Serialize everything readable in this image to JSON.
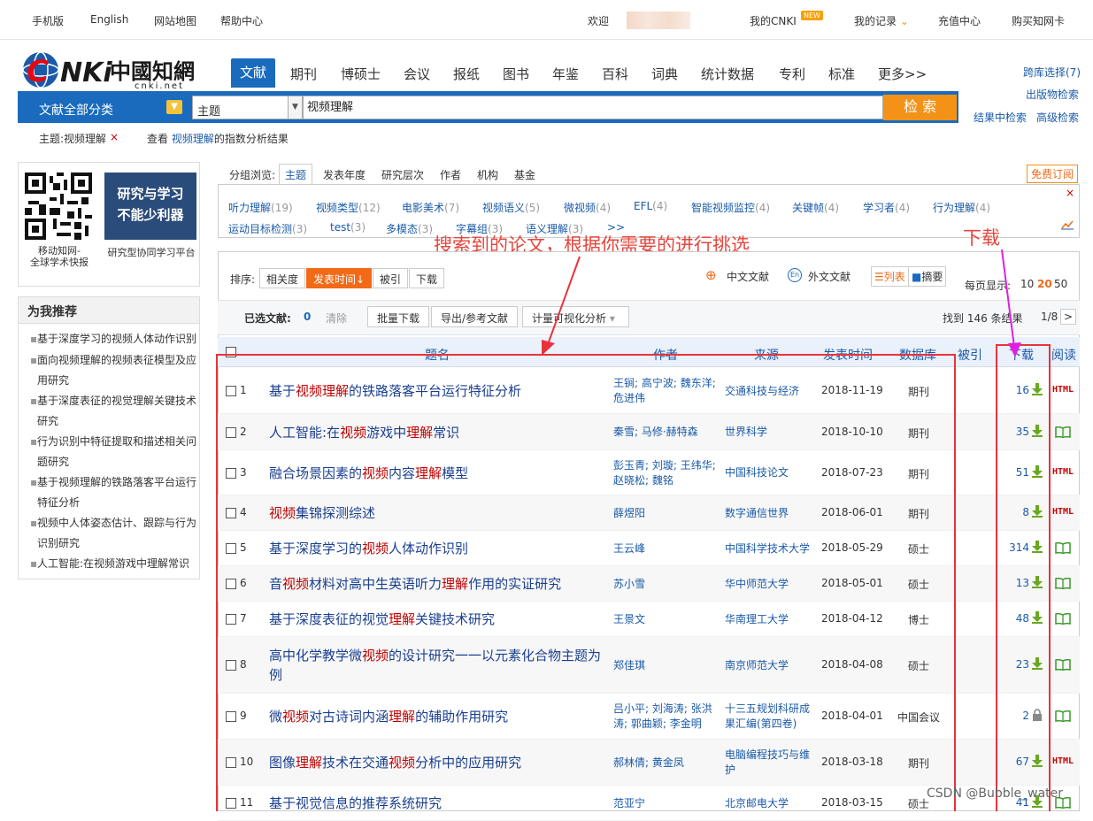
{
  "topbar": {
    "mobile": "手机版",
    "english": "English",
    "sitemap": "网站地图",
    "help": "帮助中心",
    "welcome": "欢迎",
    "mycnki": "我的CNKI",
    "new_badge": "NEW",
    "myrecords": "我的记录",
    "recharge": "充值中心",
    "buycard": "购买知网卡"
  },
  "logo": {
    "text": "CNKI中国知网",
    "url_text": "cnki.net"
  },
  "nav": [
    "文献",
    "期刊",
    "博硕士",
    "会议",
    "报纸",
    "图书",
    "年鉴",
    "百科",
    "词典",
    "统计数据",
    "专利",
    "标准",
    "更多>>"
  ],
  "right_links": {
    "cross": "跨库选择(7)",
    "pubsearch": "出版物检索",
    "inresult": "结果中检索",
    "advanced": "高级检索"
  },
  "search": {
    "category": "文献全部分类",
    "field": "主题",
    "keyword": "视频理解",
    "button": "检 索"
  },
  "crumb": {
    "topic": "主题:视频理解",
    "close": "×",
    "view_prefix": "查看",
    "view_kw": "视频理解",
    "view_suffix": "的指数分析结果"
  },
  "left": {
    "qr_caption1": "移动知网-",
    "qr_caption2": "全球学术快报",
    "promo_line1": "研究与学习",
    "promo_line2": "不能少利器",
    "promo_caption": "研究型协同学习平台",
    "rec_title": "为我推荐",
    "recs": [
      "基于深度学习的视频人体动作识别",
      "面向视频理解的视频表征模型及应",
      "用研究",
      "基于深度表征的视觉理解关键技术",
      "研究",
      "行为识别中特征提取和描述相关问",
      "题研究",
      "基于视频理解的铁路落客平台运行",
      "特征分析",
      "视频中人体姿态估计、跟踪与行为",
      "识别研究",
      "人工智能:在视频游戏中理解常识"
    ]
  },
  "group": {
    "label": "分组浏览:",
    "tabs": [
      "主题",
      "发表年度",
      "研究层次",
      "作者",
      "机构",
      "基金"
    ],
    "subscribe": "免费订阅"
  },
  "facets": [
    [
      "听力理解",
      "(19)"
    ],
    [
      "视频类型",
      "(12)"
    ],
    [
      "电影美术",
      "(7)"
    ],
    [
      "视频语义",
      "(5)"
    ],
    [
      "微视频",
      "(4)"
    ],
    [
      "EFL",
      "(4)"
    ],
    [
      "智能视频监控",
      "(4)"
    ],
    [
      "关键帧",
      "(4)"
    ],
    [
      "学习者",
      "(4)"
    ],
    [
      "行为理解",
      "(4)"
    ],
    [
      "运动目标检测",
      "(3)"
    ],
    [
      "test",
      "(3)"
    ],
    [
      "多模态",
      "(3)"
    ],
    [
      "字幕组",
      "(3)"
    ],
    [
      "语义理解",
      "(3)"
    ],
    [
      ">>",
      ""
    ]
  ],
  "annot": {
    "left": "搜索到的论文，根据你需要的进行挑选",
    "right": "下载"
  },
  "sort": {
    "label": "排序:",
    "options": [
      "相关度",
      "发表时间↓",
      "被引",
      "下载"
    ],
    "zh": "中文文献",
    "en": "外文文献",
    "list": "列表",
    "abstract": "摘要",
    "perpage": "每页显示:",
    "pp": [
      "10",
      "20",
      "50"
    ]
  },
  "toolbar": {
    "selected": "已选文献:",
    "count": "0",
    "clear": "清除",
    "batch": "批量下载",
    "export": "导出/参考文献",
    "viz": "计量可视化分析",
    "found": "找到 146 条结果",
    "page": "1/8",
    "next": ">"
  },
  "columns": [
    "题名",
    "作者",
    "来源",
    "发表时间",
    "数据库",
    "被引",
    "下载",
    "阅读"
  ],
  "rows": [
    {
      "n": "1",
      "title": [
        [
          "基于",
          0
        ],
        [
          "视频理解",
          1
        ],
        [
          "的铁路落客平台运行特征分析",
          0
        ]
      ],
      "authors": [
        "王锏; 高宁波; 魏东洋;",
        "危进伟"
      ],
      "source": [
        "交通科技与经济"
      ],
      "date": "2018-11-19",
      "db": "期刊",
      "dl": "16",
      "read": "HTML"
    },
    {
      "n": "2",
      "title": [
        [
          "人工智能:在",
          0
        ],
        [
          "视频",
          1
        ],
        [
          "游戏中",
          0
        ],
        [
          "理解",
          1
        ],
        [
          "常识",
          0
        ]
      ],
      "authors": [
        "秦雪; 马修·赫特森"
      ],
      "source": [
        "世界科学"
      ],
      "date": "2018-10-10",
      "db": "期刊",
      "dl": "35",
      "read": "book"
    },
    {
      "n": "3",
      "title": [
        [
          "融合场景因素的",
          0
        ],
        [
          "视频",
          1
        ],
        [
          "内容",
          0
        ],
        [
          "理解",
          1
        ],
        [
          "模型",
          0
        ]
      ],
      "authors": [
        "彭玉青; 刘璇; 王纬华;",
        "赵晓松; 魏铭"
      ],
      "source": [
        "中国科技论文"
      ],
      "date": "2018-07-23",
      "db": "期刊",
      "dl": "51",
      "read": "HTML"
    },
    {
      "n": "4",
      "title": [
        [
          "视频",
          1
        ],
        [
          "集锦探测综述",
          0
        ]
      ],
      "authors": [
        "薛煜阳"
      ],
      "source": [
        "数字通信世界"
      ],
      "date": "2018-06-01",
      "db": "期刊",
      "dl": "8",
      "read": "HTML"
    },
    {
      "n": "5",
      "title": [
        [
          "基于深度学习的",
          0
        ],
        [
          "视频",
          1
        ],
        [
          "人体动作识别",
          0
        ]
      ],
      "authors": [
        "王云峰"
      ],
      "source": [
        "中国科学技术大学"
      ],
      "date": "2018-05-29",
      "db": "硕士",
      "dl": "314",
      "read": "book"
    },
    {
      "n": "6",
      "title": [
        [
          "音",
          0
        ],
        [
          "视频",
          1
        ],
        [
          "材料对高中生英语听力",
          0
        ],
        [
          "理解",
          1
        ],
        [
          "作用的实证研究",
          0
        ]
      ],
      "authors": [
        "苏小雪"
      ],
      "source": [
        "华中师范大学"
      ],
      "date": "2018-05-01",
      "db": "硕士",
      "dl": "13",
      "read": "book"
    },
    {
      "n": "7",
      "title": [
        [
          "基于深度表征的视觉",
          0
        ],
        [
          "理解",
          1
        ],
        [
          "关键技术研究",
          0
        ]
      ],
      "authors": [
        "王景文"
      ],
      "source": [
        "华南理工大学"
      ],
      "date": "2018-04-12",
      "db": "博士",
      "dl": "48",
      "read": "book"
    },
    {
      "n": "8",
      "title": [
        [
          "高中化学教学微",
          0
        ],
        [
          "视频",
          1
        ],
        [
          "的设计研究一一以元素化合物主",
          0
        ],
        [
          "题为例",
          0
        ]
      ],
      "authors": [
        "郑佳琪"
      ],
      "source": [
        "南京师范大学"
      ],
      "date": "2018-04-08",
      "db": "硕士",
      "dl": "23",
      "read": "book"
    },
    {
      "n": "9",
      "title": [
        [
          "微",
          0
        ],
        [
          "视频",
          1
        ],
        [
          "对古诗词内涵",
          0
        ],
        [
          "理解",
          1
        ],
        [
          "的辅助作用研究",
          0
        ]
      ],
      "authors": [
        "吕小平; 刘海涛; 张洪",
        "涛; 郭曲颖; 李金明"
      ],
      "source": [
        "十三五规划科研成",
        "果汇编(第四卷)"
      ],
      "date": "2018-04-01",
      "db": "中国会议",
      "dl": "2",
      "read": "book"
    },
    {
      "n": "10",
      "title": [
        [
          "图像",
          0
        ],
        [
          "理解",
          1
        ],
        [
          "技术在交通",
          0
        ],
        [
          "视频",
          1
        ],
        [
          "分析中的应用研究",
          0
        ]
      ],
      "authors": [
        "郝林倩; 黄金凤"
      ],
      "source": [
        "电脑编程技巧与维",
        "护"
      ],
      "date": "2018-03-18",
      "db": "期刊",
      "dl": "67",
      "read": "HTML"
    },
    {
      "n": "11",
      "title": [
        [
          "基于视觉信息的推荐系统研究",
          0
        ]
      ],
      "authors": [
        "范亚宁"
      ],
      "source": [
        "北京邮电大学"
      ],
      "date": "2018-03-15",
      "db": "硕士",
      "dl": "41",
      "read": "book"
    }
  ],
  "watermark": "CSDN @Bubble_water",
  "colors": {
    "brand_blue": "#1a6bbd",
    "orange": "#f39216",
    "highlight": "#c00000",
    "annot": "#e8333d",
    "magenta": "#e020e0"
  }
}
